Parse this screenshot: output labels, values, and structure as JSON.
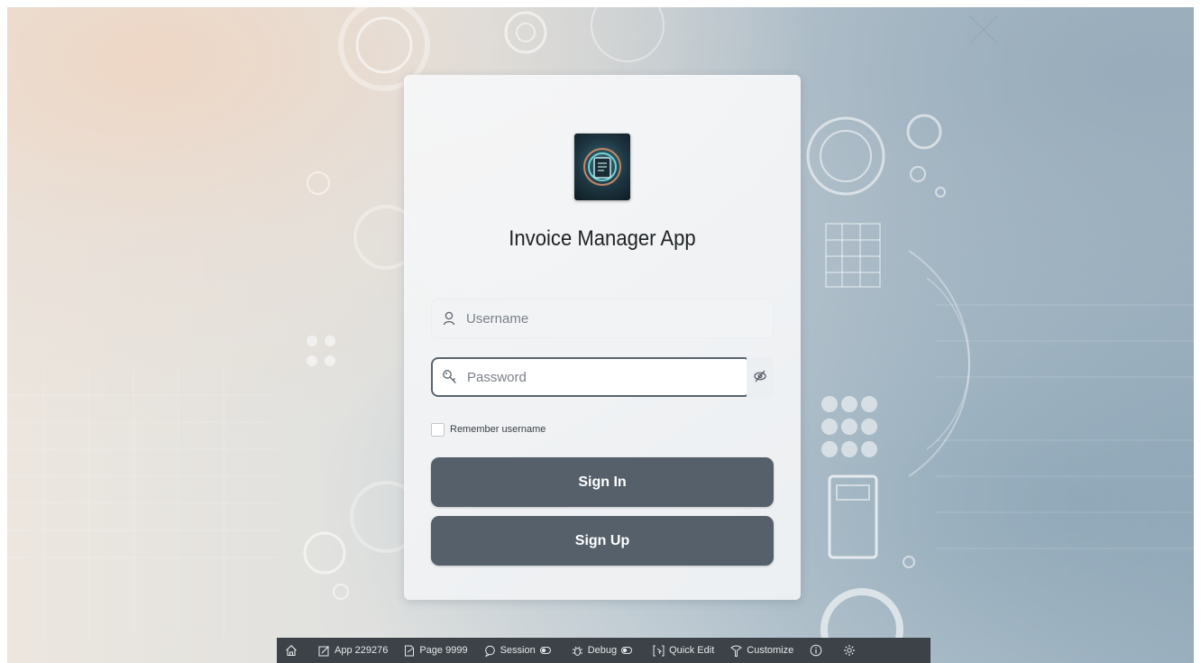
{
  "app": {
    "title": "Invoice Manager App"
  },
  "login": {
    "username_placeholder": "Username",
    "password_placeholder": "Password",
    "remember_label": "Remember username",
    "remember_checked": false,
    "sign_in_label": "Sign In",
    "sign_up_label": "Sign Up"
  },
  "icons": {
    "username": "user-icon",
    "password": "key-icon",
    "reveal": "eye-slash-icon",
    "logo": "app-logo"
  },
  "colors": {
    "button": "#55606b",
    "devbar": "#3c4248",
    "focus_border": "#5a6470"
  },
  "devbar": {
    "app": "App 229276",
    "page": "Page 9999",
    "session": "Session",
    "debug": "Debug",
    "quick_edit": "Quick Edit",
    "customize": "Customize"
  }
}
